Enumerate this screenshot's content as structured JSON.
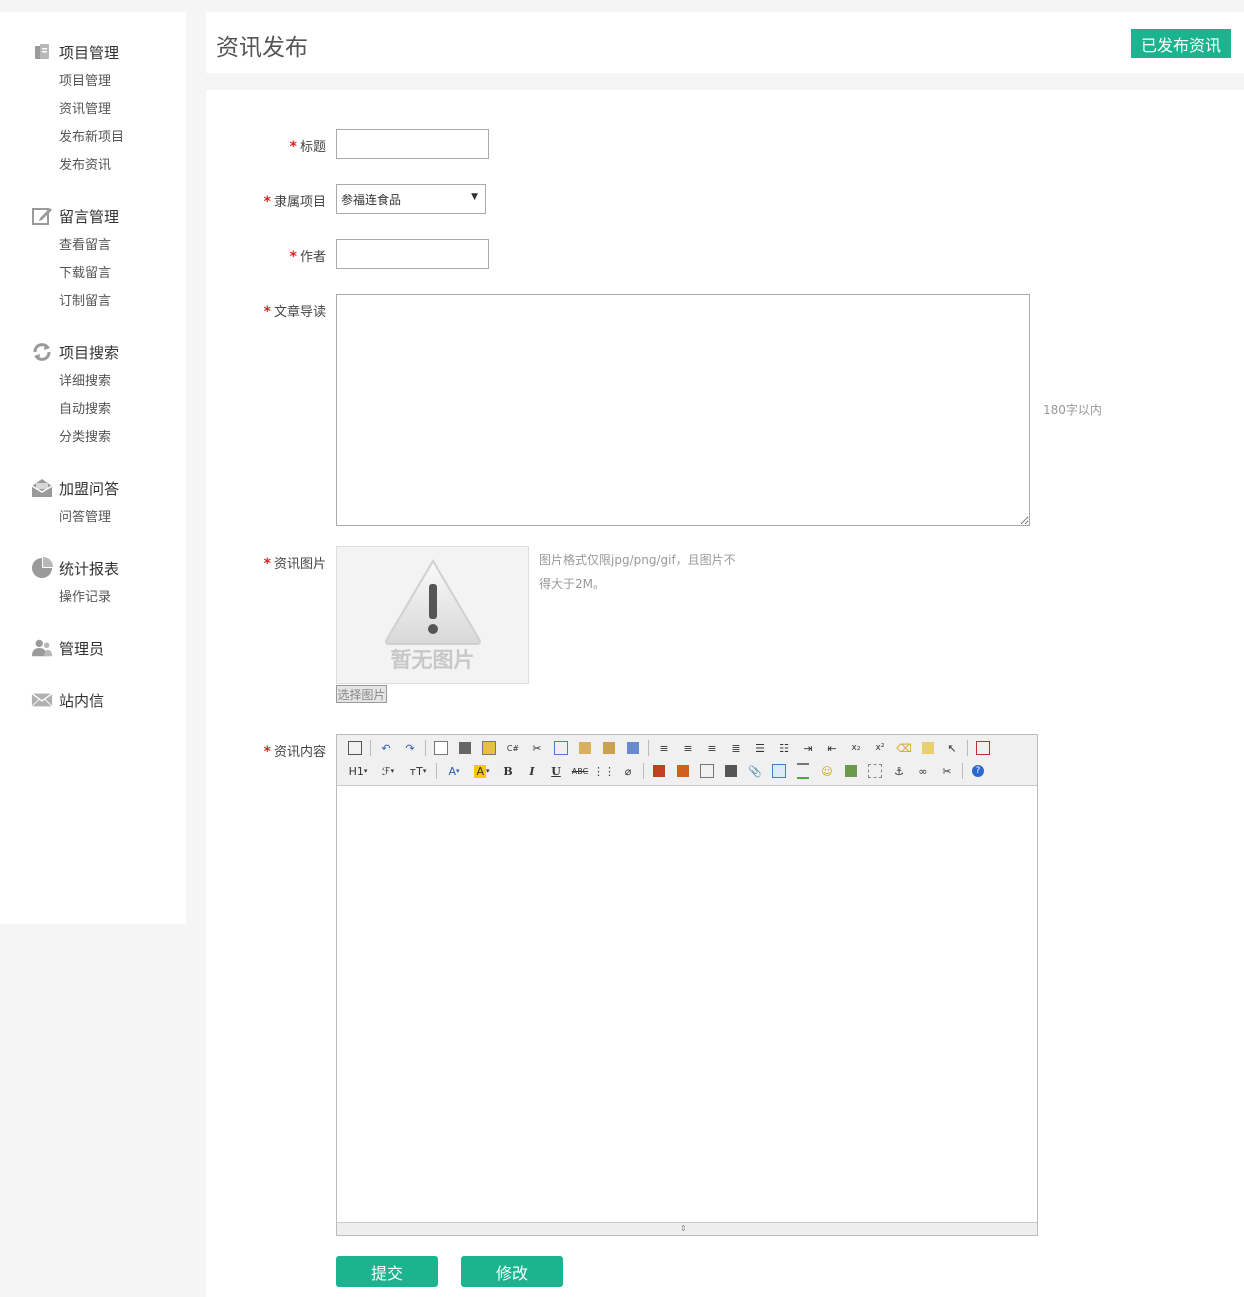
{
  "sidebar": {
    "groups": [
      {
        "title": "项目管理",
        "icon": "folder-icon",
        "items": [
          "项目管理",
          "资讯管理",
          "发布新项目",
          "发布资讯"
        ]
      },
      {
        "title": "留言管理",
        "icon": "edit-icon",
        "items": [
          "查看留言",
          "下载留言",
          "订制留言"
        ]
      },
      {
        "title": "项目搜索",
        "icon": "refresh-icon",
        "items": [
          "详细搜索",
          "自动搜索",
          "分类搜索"
        ]
      },
      {
        "title": "加盟问答",
        "icon": "mail-open-icon",
        "items": [
          "问答管理"
        ]
      },
      {
        "title": "统计报表",
        "icon": "pie-chart-icon",
        "items": [
          "操作记录"
        ]
      },
      {
        "title": "管理员",
        "icon": "users-icon",
        "items": []
      },
      {
        "title": "站内信",
        "icon": "envelope-icon",
        "items": []
      }
    ]
  },
  "header": {
    "title": "资讯发布",
    "published_button": "已发布资讯"
  },
  "form": {
    "required_mark": "*",
    "title_label": "标题",
    "title_value": "",
    "project_label": "隶属项目",
    "project_selected": "参福连食品",
    "author_label": "作者",
    "author_value": "",
    "summary_label": "文章导读",
    "summary_value": "",
    "summary_hint": "180字以内",
    "image_label": "资讯图片",
    "image_placeholder_text": "暂无图片",
    "image_hint_line1": "图片格式仅限jpg/png/gif，且图片不",
    "image_hint_line2": "得大于2M。",
    "choose_image_button": "选择图片",
    "content_label": "资讯内容",
    "submit_button": "提交",
    "modify_button": "修改"
  },
  "editor": {
    "heading_label": "H1",
    "font_label": "ℱ",
    "size_label": "тT",
    "font_color_label": "A",
    "bg_color_label": "A",
    "bold_label": "B",
    "italic_label": "I",
    "underline_label": "U",
    "strike_label": "ABC"
  },
  "colors": {
    "accent": "#1bb48e",
    "required": "#e02020"
  }
}
